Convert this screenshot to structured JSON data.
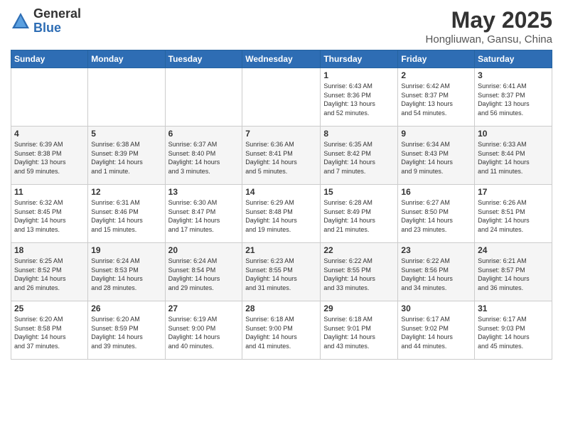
{
  "header": {
    "logo_general": "General",
    "logo_blue": "Blue",
    "title": "May 2025",
    "subtitle": "Hongliuwan, Gansu, China"
  },
  "weekdays": [
    "Sunday",
    "Monday",
    "Tuesday",
    "Wednesday",
    "Thursday",
    "Friday",
    "Saturday"
  ],
  "weeks": [
    [
      {
        "day": "",
        "info": ""
      },
      {
        "day": "",
        "info": ""
      },
      {
        "day": "",
        "info": ""
      },
      {
        "day": "",
        "info": ""
      },
      {
        "day": "1",
        "info": "Sunrise: 6:43 AM\nSunset: 8:36 PM\nDaylight: 13 hours\nand 52 minutes."
      },
      {
        "day": "2",
        "info": "Sunrise: 6:42 AM\nSunset: 8:37 PM\nDaylight: 13 hours\nand 54 minutes."
      },
      {
        "day": "3",
        "info": "Sunrise: 6:41 AM\nSunset: 8:37 PM\nDaylight: 13 hours\nand 56 minutes."
      }
    ],
    [
      {
        "day": "4",
        "info": "Sunrise: 6:39 AM\nSunset: 8:38 PM\nDaylight: 13 hours\nand 59 minutes."
      },
      {
        "day": "5",
        "info": "Sunrise: 6:38 AM\nSunset: 8:39 PM\nDaylight: 14 hours\nand 1 minute."
      },
      {
        "day": "6",
        "info": "Sunrise: 6:37 AM\nSunset: 8:40 PM\nDaylight: 14 hours\nand 3 minutes."
      },
      {
        "day": "7",
        "info": "Sunrise: 6:36 AM\nSunset: 8:41 PM\nDaylight: 14 hours\nand 5 minutes."
      },
      {
        "day": "8",
        "info": "Sunrise: 6:35 AM\nSunset: 8:42 PM\nDaylight: 14 hours\nand 7 minutes."
      },
      {
        "day": "9",
        "info": "Sunrise: 6:34 AM\nSunset: 8:43 PM\nDaylight: 14 hours\nand 9 minutes."
      },
      {
        "day": "10",
        "info": "Sunrise: 6:33 AM\nSunset: 8:44 PM\nDaylight: 14 hours\nand 11 minutes."
      }
    ],
    [
      {
        "day": "11",
        "info": "Sunrise: 6:32 AM\nSunset: 8:45 PM\nDaylight: 14 hours\nand 13 minutes."
      },
      {
        "day": "12",
        "info": "Sunrise: 6:31 AM\nSunset: 8:46 PM\nDaylight: 14 hours\nand 15 minutes."
      },
      {
        "day": "13",
        "info": "Sunrise: 6:30 AM\nSunset: 8:47 PM\nDaylight: 14 hours\nand 17 minutes."
      },
      {
        "day": "14",
        "info": "Sunrise: 6:29 AM\nSunset: 8:48 PM\nDaylight: 14 hours\nand 19 minutes."
      },
      {
        "day": "15",
        "info": "Sunrise: 6:28 AM\nSunset: 8:49 PM\nDaylight: 14 hours\nand 21 minutes."
      },
      {
        "day": "16",
        "info": "Sunrise: 6:27 AM\nSunset: 8:50 PM\nDaylight: 14 hours\nand 23 minutes."
      },
      {
        "day": "17",
        "info": "Sunrise: 6:26 AM\nSunset: 8:51 PM\nDaylight: 14 hours\nand 24 minutes."
      }
    ],
    [
      {
        "day": "18",
        "info": "Sunrise: 6:25 AM\nSunset: 8:52 PM\nDaylight: 14 hours\nand 26 minutes."
      },
      {
        "day": "19",
        "info": "Sunrise: 6:24 AM\nSunset: 8:53 PM\nDaylight: 14 hours\nand 28 minutes."
      },
      {
        "day": "20",
        "info": "Sunrise: 6:24 AM\nSunset: 8:54 PM\nDaylight: 14 hours\nand 29 minutes."
      },
      {
        "day": "21",
        "info": "Sunrise: 6:23 AM\nSunset: 8:55 PM\nDaylight: 14 hours\nand 31 minutes."
      },
      {
        "day": "22",
        "info": "Sunrise: 6:22 AM\nSunset: 8:55 PM\nDaylight: 14 hours\nand 33 minutes."
      },
      {
        "day": "23",
        "info": "Sunrise: 6:22 AM\nSunset: 8:56 PM\nDaylight: 14 hours\nand 34 minutes."
      },
      {
        "day": "24",
        "info": "Sunrise: 6:21 AM\nSunset: 8:57 PM\nDaylight: 14 hours\nand 36 minutes."
      }
    ],
    [
      {
        "day": "25",
        "info": "Sunrise: 6:20 AM\nSunset: 8:58 PM\nDaylight: 14 hours\nand 37 minutes."
      },
      {
        "day": "26",
        "info": "Sunrise: 6:20 AM\nSunset: 8:59 PM\nDaylight: 14 hours\nand 39 minutes."
      },
      {
        "day": "27",
        "info": "Sunrise: 6:19 AM\nSunset: 9:00 PM\nDaylight: 14 hours\nand 40 minutes."
      },
      {
        "day": "28",
        "info": "Sunrise: 6:18 AM\nSunset: 9:00 PM\nDaylight: 14 hours\nand 41 minutes."
      },
      {
        "day": "29",
        "info": "Sunrise: 6:18 AM\nSunset: 9:01 PM\nDaylight: 14 hours\nand 43 minutes."
      },
      {
        "day": "30",
        "info": "Sunrise: 6:17 AM\nSunset: 9:02 PM\nDaylight: 14 hours\nand 44 minutes."
      },
      {
        "day": "31",
        "info": "Sunrise: 6:17 AM\nSunset: 9:03 PM\nDaylight: 14 hours\nand 45 minutes."
      }
    ]
  ]
}
